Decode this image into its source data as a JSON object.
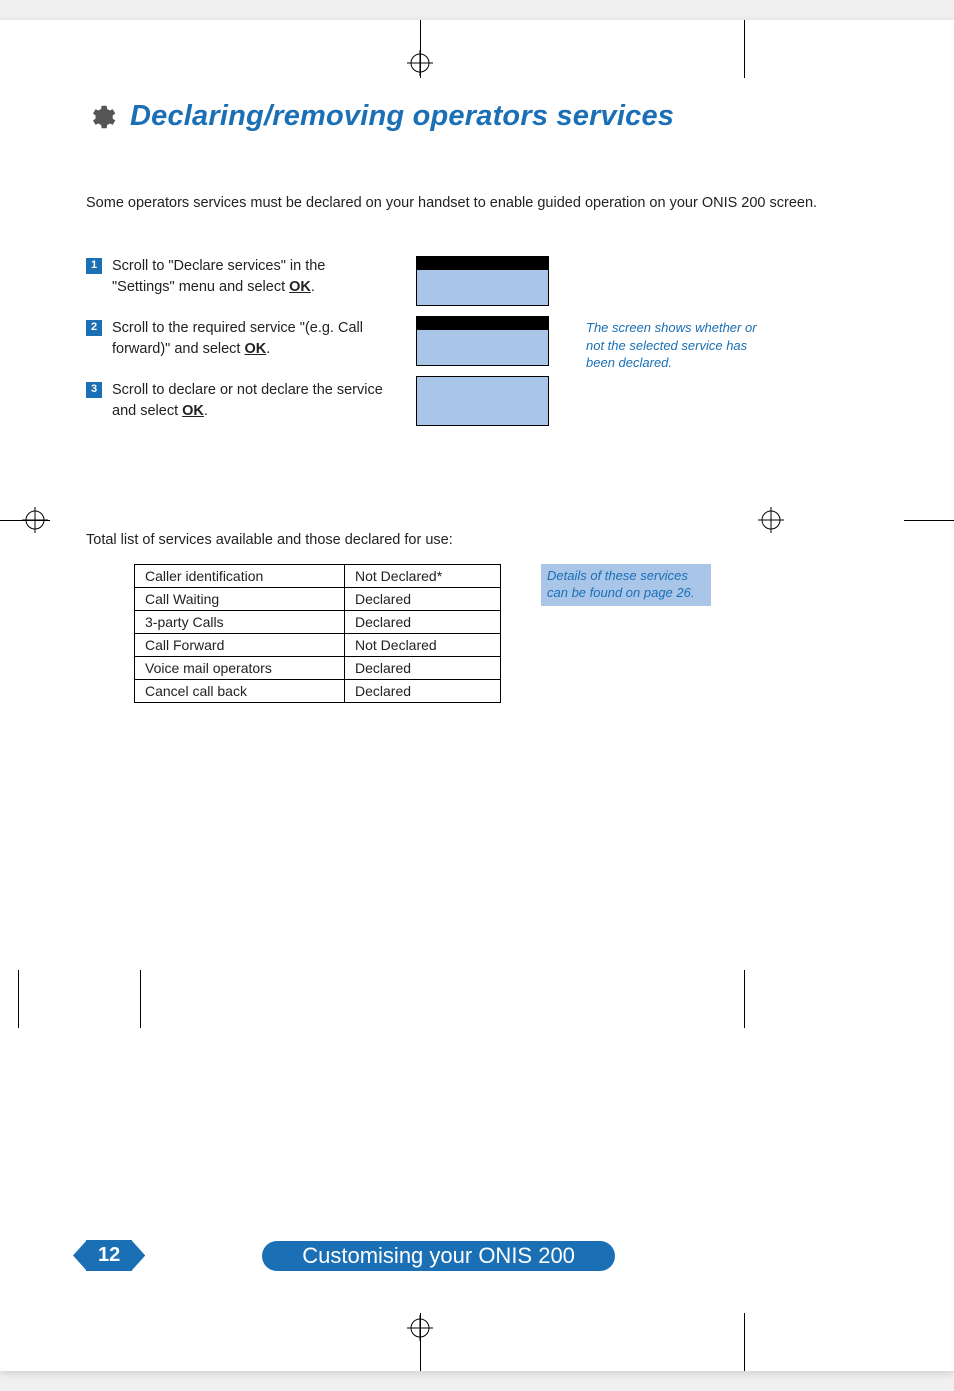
{
  "heading": "Declaring/removing operators services",
  "intro": "Some operators services must be declared on your handset to enable guided operation on your ONIS 200 screen.",
  "steps": [
    {
      "num": "1",
      "pre": "Scroll to \"Declare services\" in the \"Settings\" menu and select ",
      "ok": "OK",
      "post": "."
    },
    {
      "num": "2",
      "pre": "Scroll to the required service \"(e.g. Call forward)\" and select ",
      "ok": "OK",
      "post": "."
    },
    {
      "num": "3",
      "pre": "Scroll to declare or not declare the service and select ",
      "ok": "OK",
      "post": "."
    }
  ],
  "side_note": "The screen shows whether or not the selected service has been declared.",
  "table_intro": "Total list of services available and those declared for use:",
  "services": [
    {
      "name": "Caller identification",
      "status": "Not Declared*"
    },
    {
      "name": "Call Waiting",
      "status": "Declared"
    },
    {
      "name": "3-party Calls",
      "status": "Declared"
    },
    {
      "name": "Call Forward",
      "status": "Not Declared"
    },
    {
      "name": "Voice mail operators",
      "status": "Declared"
    },
    {
      "name": "Cancel call back",
      "status": "Declared"
    }
  ],
  "table_note": "Details of these services can be found on page 26.",
  "page_number": "12",
  "footer_title": "Customising your ONIS 200"
}
